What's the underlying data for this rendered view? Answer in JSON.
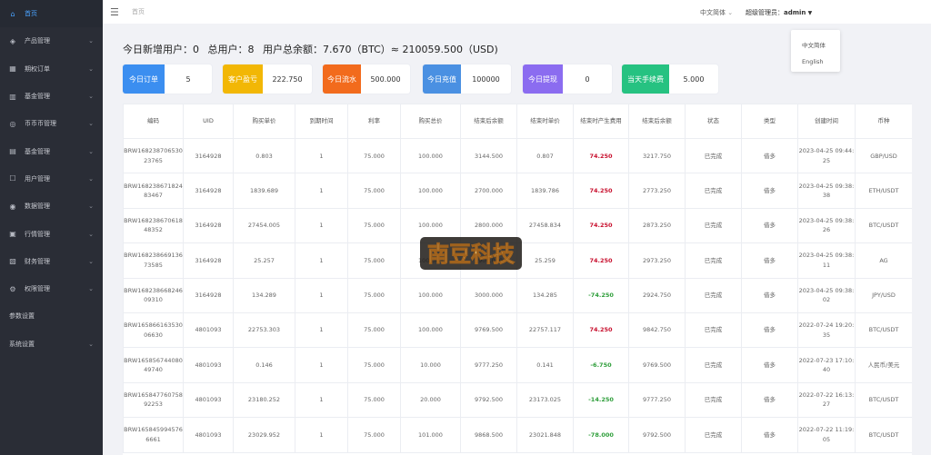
{
  "sidebar": {
    "items": [
      {
        "label": "首页",
        "icon": "home-icon",
        "active": true,
        "glyph": "⌂",
        "chevron": false
      },
      {
        "label": "产品管理",
        "icon": "cube-icon",
        "glyph": "◈",
        "chevron": true
      },
      {
        "label": "期权订单",
        "icon": "order-icon",
        "glyph": "▦",
        "chevron": true
      },
      {
        "label": "基金管理",
        "icon": "fund-icon",
        "glyph": "▥",
        "chevron": true
      },
      {
        "label": "币币币管理",
        "icon": "coin-icon",
        "glyph": "◎",
        "chevron": true
      },
      {
        "label": "基金管理",
        "icon": "wallet-icon",
        "glyph": "▤",
        "chevron": true
      },
      {
        "label": "用户管理",
        "icon": "user-icon",
        "glyph": "☐",
        "chevron": true
      },
      {
        "label": "数据管理",
        "icon": "data-icon",
        "glyph": "◉",
        "chevron": true
      },
      {
        "label": "行情管理",
        "icon": "chart-icon",
        "glyph": "▣",
        "chevron": true
      },
      {
        "label": "财务管理",
        "icon": "finance-icon",
        "glyph": "▧",
        "chevron": true
      },
      {
        "label": "权限管理",
        "icon": "gear-icon",
        "glyph": "⚙",
        "chevron": true
      },
      {
        "label": "参数设置",
        "icon": "",
        "glyph": "",
        "chevron": false
      },
      {
        "label": "系统设置",
        "icon": "",
        "glyph": "",
        "chevron": true
      }
    ]
  },
  "header": {
    "breadcrumb": "首页",
    "lang_label": "中文简体",
    "admin_label": "超级管理员：",
    "admin_name": "admin"
  },
  "lang_menu": [
    "中文简体",
    "English"
  ],
  "summary": {
    "new_users_label": "今日新增用户：",
    "new_users": "0",
    "total_users_label": "总用户：",
    "total_users": "8",
    "balance_label": "用户总余额：",
    "balance": "7.670（BTC）≈ 210059.500（USD)"
  },
  "cards": [
    {
      "label": "今日订单",
      "value": "5",
      "color": "#3b8ef0"
    },
    {
      "label": "客户盈亏",
      "value": "222.750",
      "color": "#f2b705"
    },
    {
      "label": "今日流水",
      "value": "500.000",
      "color": "#f26b1d"
    },
    {
      "label": "今日充值",
      "value": "100000",
      "color": "#4a90e2"
    },
    {
      "label": "今日提现",
      "value": "0",
      "color": "#8b6cf0"
    },
    {
      "label": "当天手续费",
      "value": "5.000",
      "color": "#26c281"
    }
  ],
  "colors": {
    "negative": "#c8102e",
    "positive": "#2e9e3a",
    "active_nav": "#4aa3ff"
  },
  "table": {
    "headers": [
      "编码",
      "UID",
      "购买单价",
      "到期时间",
      "利率",
      "购买总价",
      "结束后余额",
      "结束时单价",
      "结束时产生费用",
      "结束后余额",
      "状态",
      "类型",
      "创建时间",
      "币种"
    ],
    "rows": [
      [
        "BRW16823870653023765",
        "3164928",
        "0.803",
        "1",
        "75.000",
        "100.000",
        "3144.500",
        "0.807",
        "74.250",
        "3217.750",
        "已完成",
        "借多",
        "2023-04-25 09:44:25",
        "GBP/USD"
      ],
      [
        "BRW16823867182483467",
        "3164928",
        "1839.689",
        "1",
        "75.000",
        "100.000",
        "2700.000",
        "1839.786",
        "74.250",
        "2773.250",
        "已完成",
        "借多",
        "2023-04-25 09:38:38",
        "ETH/USDT"
      ],
      [
        "BRW16823867061848352",
        "3164928",
        "27454.005",
        "1",
        "75.000",
        "100.000",
        "2800.000",
        "27458.834",
        "74.250",
        "2873.250",
        "已完成",
        "借多",
        "2023-04-25 09:38:26",
        "BTC/USDT"
      ],
      [
        "BRW16823866913673585",
        "3164928",
        "25.257",
        "1",
        "75.000",
        "100.000",
        "2900.000",
        "25.259",
        "74.250",
        "2973.250",
        "已完成",
        "借多",
        "2023-04-25 09:38:11",
        "AG"
      ],
      [
        "BRW16823866824609310",
        "3164928",
        "134.289",
        "1",
        "75.000",
        "100.000",
        "3000.000",
        "134.285",
        "-74.250",
        "2924.750",
        "已完成",
        "借多",
        "2023-04-25 09:38:02",
        "JPY/USD"
      ],
      [
        "BRW16586616353006630",
        "4801093",
        "22753.303",
        "1",
        "75.000",
        "100.000",
        "9769.500",
        "22757.117",
        "74.250",
        "9842.750",
        "已完成",
        "借多",
        "2022-07-24 19:20:35",
        "BTC/USDT"
      ],
      [
        "BRW16585674408049740",
        "4801093",
        "0.146",
        "1",
        "75.000",
        "10.000",
        "9777.250",
        "0.141",
        "-6.750",
        "9769.500",
        "已完成",
        "借多",
        "2022-07-23 17:10:40",
        "人民币/美元"
      ],
      [
        "BRW16584776075892253",
        "4801093",
        "23180.252",
        "1",
        "75.000",
        "20.000",
        "9792.500",
        "23173.025",
        "-14.250",
        "9777.250",
        "已完成",
        "借多",
        "2022-07-22 16:13:27",
        "BTC/USDT"
      ],
      [
        "BRW1658459945766661",
        "4801093",
        "23029.952",
        "1",
        "75.000",
        "101.000",
        "9868.500",
        "23021.848",
        "-78.000",
        "9792.500",
        "已完成",
        "借多",
        "2022-07-22 11:19:05",
        "BTC/USDT"
      ]
    ]
  },
  "watermark": {
    "text": "南豆科技"
  }
}
